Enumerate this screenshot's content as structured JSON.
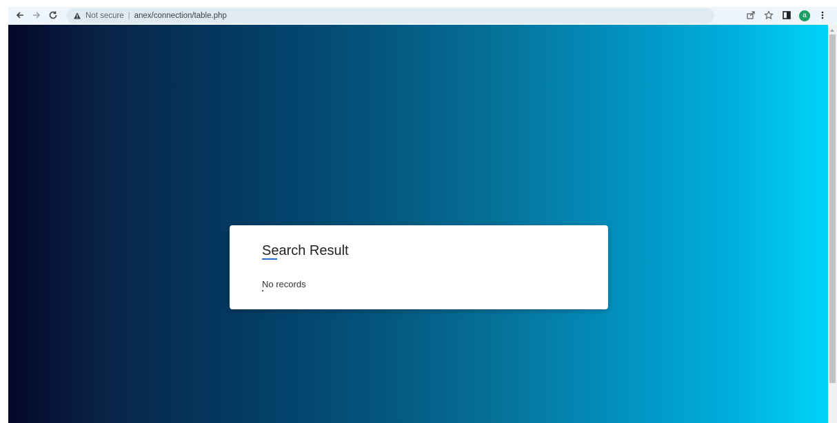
{
  "browser": {
    "address_bar": {
      "security_label": "Not secure",
      "separator": "|",
      "url": "anex/connection/table.php"
    },
    "profile_initial": "a",
    "icons": {
      "back": "arrow-left-icon",
      "forward": "arrow-right-icon",
      "reload": "reload-icon",
      "warning": "warning-triangle-icon",
      "share": "share-icon",
      "bookmark": "star-icon",
      "sidepanel": "side-panel-icon",
      "menu": "kebab-menu-icon"
    }
  },
  "page": {
    "card": {
      "title": "Search Result",
      "message": "No records"
    }
  },
  "colors": {
    "gradient_start": "#04072a",
    "gradient_end": "#00d3f8",
    "card_background": "#ffffff",
    "title_underline": "#1f6fd1",
    "avatar": "#1e9e63"
  }
}
